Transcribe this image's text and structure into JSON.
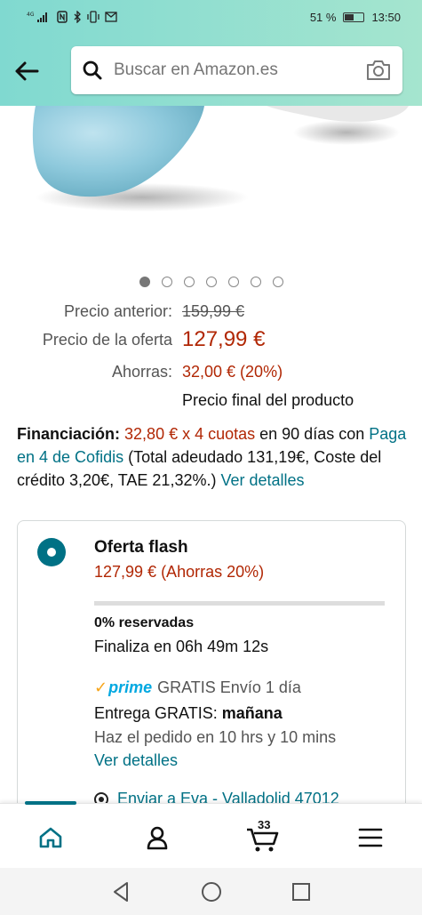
{
  "statusbar": {
    "left_icons": [
      "4G signal",
      "NFC",
      "bluetooth",
      "vibrate",
      "mail"
    ],
    "battery_text": "51 %",
    "battery_level": 0.51,
    "time": "13:50"
  },
  "search": {
    "placeholder": "Buscar en Amazon.es"
  },
  "gallery": {
    "total_images": 7,
    "active_index": 0
  },
  "pricing": {
    "previous_label": "Precio anterior:",
    "previous_value": "159,99 €",
    "offer_label": "Precio de la oferta",
    "offer_value": "127,99 €",
    "savings_label": "Ahorras:",
    "savings_value": "32,00 € (20%)",
    "final_note": "Precio final del producto"
  },
  "financing": {
    "label": "Financiación:",
    "installments": "32,80 € x 4 cuotas",
    "text1": " en 90 días con ",
    "provider_link": "Paga en 4 de Cofidis",
    "text2": " (Total adeudado 131,19€, Coste del crédito 3,20€, TAE 21,32%.) ",
    "details_link": "Ver detalles"
  },
  "offer": {
    "title": "Oferta flash",
    "price": "127,99 € (Ahorras 20%)",
    "reserved_pct": 0,
    "reserved_label": "0% reservadas",
    "ends": "Finaliza en 06h 49m 12s",
    "prime_label": "prime",
    "prime_shipping": "GRATIS Envío 1 día",
    "delivery_prefix": "Entrega GRATIS: ",
    "delivery_day": "mañana",
    "order_by": "Haz el pedido en 10 hrs y 10 mins",
    "details_link": "Ver detalles",
    "ship_to": "Enviar a Eva - Valladolid 47012"
  },
  "bottom_nav": {
    "cart_count": "33",
    "items": [
      "home-icon",
      "account-icon",
      "cart-icon",
      "menu-icon"
    ]
  },
  "colors": {
    "price_red": "#b12704",
    "link_teal": "#007185",
    "header_gradient": [
      "#80d9d0",
      "#a5e5cf"
    ]
  }
}
